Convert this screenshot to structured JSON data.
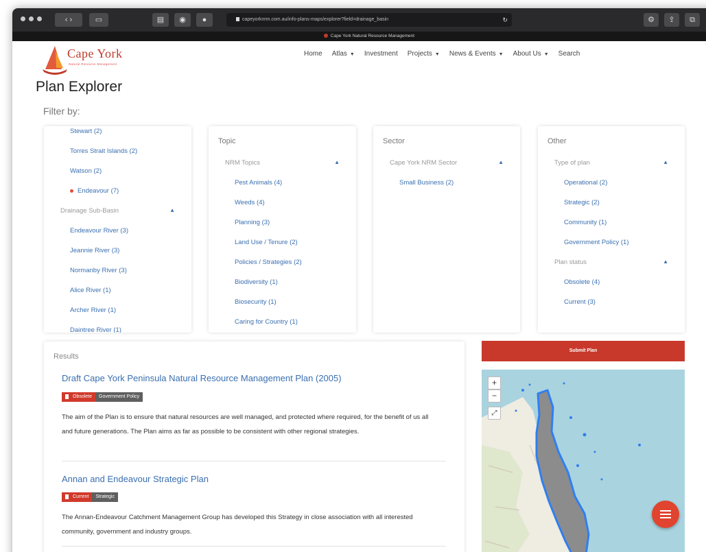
{
  "browser": {
    "url": "capeyorknrm.com.au/info-plans-maps/explorer?field=drainage_basin",
    "tab_title": "Cape York Natural Resource Management"
  },
  "site": {
    "logo_text": "Cape York",
    "logo_tagline": "Natural Resource Management",
    "nav": [
      {
        "label": "Home",
        "dropdown": false
      },
      {
        "label": "Atlas",
        "dropdown": true
      },
      {
        "label": "Investment",
        "dropdown": false
      },
      {
        "label": "Projects",
        "dropdown": true
      },
      {
        "label": "News & Events",
        "dropdown": true
      },
      {
        "label": "About Us",
        "dropdown": true
      },
      {
        "label": "Search",
        "dropdown": false
      }
    ]
  },
  "page": {
    "title": "Plan Explorer",
    "filter_label": "Filter by:"
  },
  "filters": {
    "location": {
      "items": [
        {
          "label": "Stewart (2)",
          "type": "link"
        },
        {
          "label": "Torres Strait Islands (2)",
          "type": "link"
        },
        {
          "label": "Watson (2)",
          "type": "link"
        },
        {
          "label": "Endeavour (7)",
          "type": "selected"
        },
        {
          "label": "Drainage Sub-Basin",
          "type": "group"
        },
        {
          "label": "Endeavour River (3)",
          "type": "link"
        },
        {
          "label": "Jeannie River (3)",
          "type": "link"
        },
        {
          "label": "Normanby River (3)",
          "type": "link"
        },
        {
          "label": "Alice River (1)",
          "type": "link"
        },
        {
          "label": "Archer River (1)",
          "type": "link"
        },
        {
          "label": "Daintree River (1)",
          "type": "link"
        }
      ]
    },
    "topic": {
      "heading": "Topic",
      "items": [
        {
          "label": "NRM Topics",
          "type": "group"
        },
        {
          "label": "Pest Animals (4)",
          "type": "link"
        },
        {
          "label": "Weeds (4)",
          "type": "link"
        },
        {
          "label": "Planning (3)",
          "type": "link"
        },
        {
          "label": "Land Use / Tenure (2)",
          "type": "link"
        },
        {
          "label": "Policies / Strategies (2)",
          "type": "link"
        },
        {
          "label": "Biodiversity (1)",
          "type": "link"
        },
        {
          "label": "Biosecurity (1)",
          "type": "link"
        },
        {
          "label": "Caring for Country (1)",
          "type": "link"
        }
      ]
    },
    "sector": {
      "heading": "Sector",
      "items": [
        {
          "label": "Cape York NRM Sector",
          "type": "group"
        },
        {
          "label": "Small Business (2)",
          "type": "link"
        }
      ]
    },
    "other": {
      "heading": "Other",
      "items": [
        {
          "label": "Type of plan",
          "type": "group"
        },
        {
          "label": "Operational (2)",
          "type": "link"
        },
        {
          "label": "Strategic (2)",
          "type": "link"
        },
        {
          "label": "Community (1)",
          "type": "link"
        },
        {
          "label": "Government Policy (1)",
          "type": "link"
        },
        {
          "label": "Plan status",
          "type": "group"
        },
        {
          "label": "Obsolete (4)",
          "type": "link"
        },
        {
          "label": "Current (3)",
          "type": "link"
        }
      ]
    }
  },
  "results": {
    "heading": "Results",
    "items": [
      {
        "title": "Draft Cape York Peninsula Natural Resource Management Plan (2005)",
        "status": "Obsolete",
        "category": "Government Policy",
        "description": "The aim of the Plan is to ensure that natural resources are well managed, and protected where required, for the benefit of us all and future generations. The Plan aims as far as possible to be consistent with other regional strategies."
      },
      {
        "title": "Annan and Endeavour Strategic Plan",
        "status": "Current",
        "category": "Strategic",
        "description": "The Annan-Endeavour Catchment Management Group has developed this Strategy in close association with all interested community, government and industry groups."
      }
    ]
  },
  "sidebar": {
    "submit_label": "Submit Plan",
    "map_zoom_in": "+",
    "map_zoom_out": "−"
  },
  "colors": {
    "accent": "#c8392b",
    "link": "#3a6fb0",
    "catchment": "#8c8c8c",
    "catchment_outline": "#2f7ff0"
  }
}
